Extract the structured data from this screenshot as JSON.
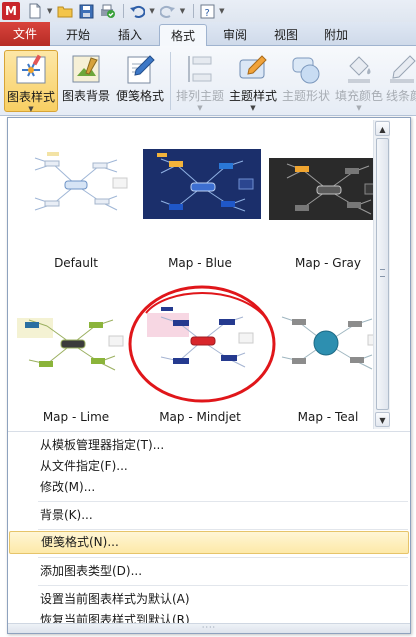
{
  "quick_access": {
    "logo_letter": "M"
  },
  "tabs": {
    "file": "文件",
    "home": "开始",
    "insert": "插入",
    "format": "格式",
    "review": "审阅",
    "view": "视图",
    "addins": "附加"
  },
  "ribbon": {
    "map_style": "图表样式",
    "map_background": "图表背景",
    "callout_style": "便笺格式",
    "arrange_topics": "排列主题",
    "topic_style": "主题样式",
    "topic_shape": "主题形状",
    "fill_color": "填充颜色",
    "line_color": "线条颜"
  },
  "gallery": {
    "items": [
      {
        "label": "Default"
      },
      {
        "label": "Map - Blue"
      },
      {
        "label": "Map - Gray"
      },
      {
        "label": "Map - Lime"
      },
      {
        "label": "Map - Mindjet"
      },
      {
        "label": "Map - Teal"
      }
    ]
  },
  "menu": {
    "items": [
      {
        "label": "从模板管理器指定(T)..."
      },
      {
        "label": "从文件指定(F)..."
      },
      {
        "label": "修改(M)..."
      },
      {
        "label": "背景(K)..."
      },
      {
        "label": "便笺格式(N)..."
      },
      {
        "label": "添加图表类型(D)..."
      },
      {
        "label": "设置当前图表样式为默认(A)"
      },
      {
        "label": "恢复当前图表样式到默认(R)"
      }
    ]
  },
  "colors": {
    "file_tab": "#c8302a",
    "selected_button": "#f8cf63",
    "highlight_circle": "#e0161a",
    "blue_theme_bg": "#1b2f6b",
    "gray_theme_bg": "#2a2a2a"
  }
}
